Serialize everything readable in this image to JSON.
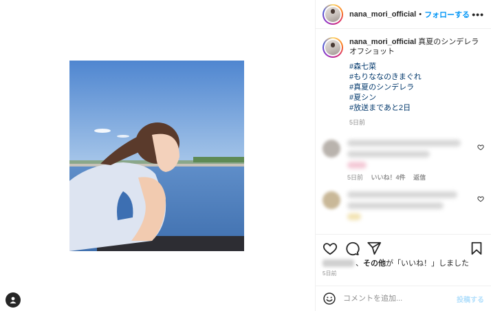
{
  "post": {
    "username": "nana_mori_official",
    "separator": "•",
    "follow_label": "フォローする",
    "more_label": "•••"
  },
  "caption": {
    "username": "nana_mori_official",
    "text": "真夏のシンデレラオフショット",
    "hashtags": [
      "#森七菜",
      "#もりななのきまぐれ",
      "#真夏のシンデレラ",
      "#夏シン",
      "#放送まであと2日"
    ],
    "time": "5日前"
  },
  "comments": [
    {
      "time": "5日前",
      "likes": "いいね！4件",
      "reply": "返信"
    }
  ],
  "likes": {
    "text_bold": "その他",
    "text_rest": "が「いいね！」しました",
    "separator": "、"
  },
  "post_time": "5日前",
  "comment_box": {
    "placeholder": "コメントを追加...",
    "post_label": "投稿する"
  },
  "icons": {
    "like": "heart-icon",
    "comment": "comment-icon",
    "share": "share-icon",
    "save": "bookmark-icon",
    "emoji": "emoji-icon",
    "user": "user-icon"
  },
  "colors": {
    "accent": "#0095f6",
    "hashtag": "#00376b",
    "muted": "#8e8e8e"
  }
}
